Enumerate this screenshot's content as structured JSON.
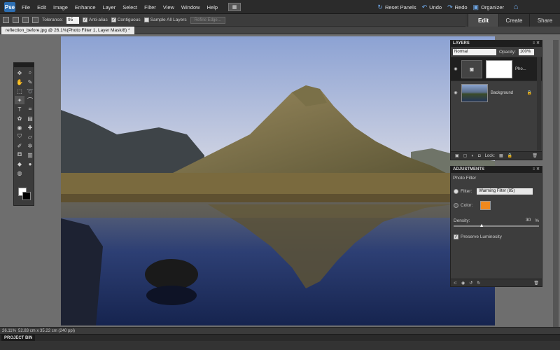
{
  "menubar": {
    "logo": "Pse",
    "items": [
      "File",
      "Edit",
      "Image",
      "Enhance",
      "Layer",
      "Select",
      "Filter",
      "View",
      "Window",
      "Help"
    ],
    "right": {
      "reset": "Reset Panels",
      "undo": "Undo",
      "redo": "Redo",
      "organizer": "Organizer"
    }
  },
  "modes": [
    "Edit",
    "Create",
    "Share"
  ],
  "options": {
    "tolerance_label": "Tolerance:",
    "tolerance_value": "95",
    "anti_alias": "Anti-alias",
    "contiguous": "Contiguous",
    "sample_all": "Sample All Layers",
    "refine": "Refine Edge..."
  },
  "document": {
    "tab": "reflection_before.jpg @ 26.1%(Photo Filter 1, Layer Mask/8) *"
  },
  "layers": {
    "title": "LAYERS",
    "blend_mode": "Normal",
    "opacity_label": "Opacity:",
    "opacity_value": "100%",
    "rows": [
      {
        "name": "Pho..."
      },
      {
        "name": "Background"
      }
    ],
    "lock_label": "Lock:"
  },
  "adjustments": {
    "title": "ADJUSTMENTS",
    "subtitle": "Photo Filter",
    "filter_label": "Filter:",
    "filter_value": "Warming Filter (85)",
    "color_label": "Color:",
    "color_value": "#f0891e",
    "density_label": "Density:",
    "density_value": "30",
    "density_unit": "%",
    "density_fraction": 0.3,
    "preserve": "Preserve Luminosity"
  },
  "status": {
    "zoom": "26.11%",
    "docsize": "52.83 cm x 35.22 cm (240 ppi)"
  },
  "project_bin": "PROJECT BIN"
}
